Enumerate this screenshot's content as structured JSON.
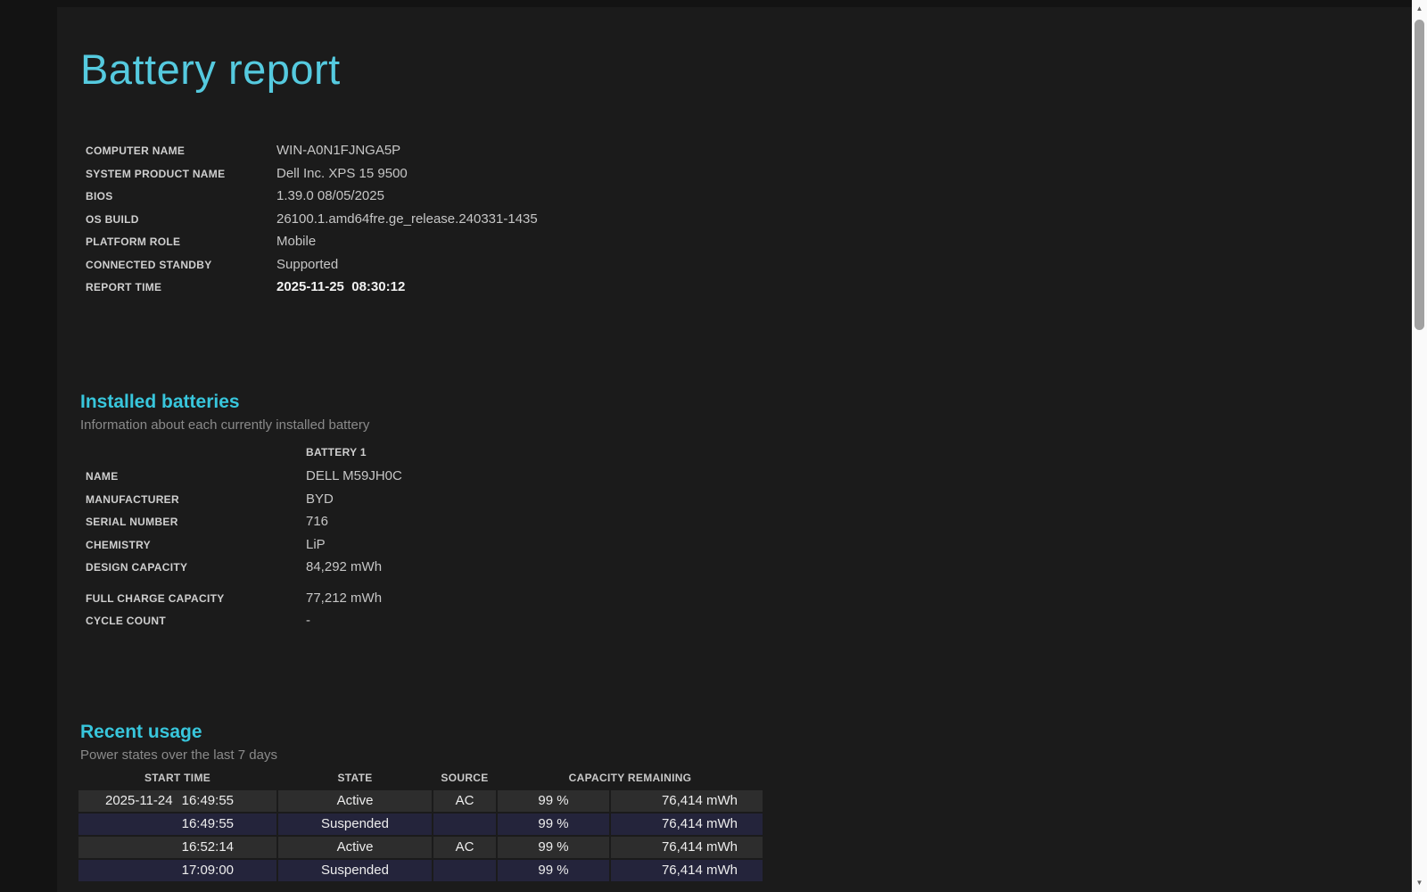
{
  "colors": {
    "outer_background": "#131313",
    "page_background": "#1b1b1b",
    "title_accent": "#55cadf",
    "heading_accent": "#38c6dc",
    "active_row_background": "#2d2d2d",
    "suspended_row_background": "#24243b"
  },
  "report": {
    "title": "Battery report"
  },
  "system_info": {
    "rows": [
      {
        "label": "COMPUTER NAME",
        "value": "WIN-A0N1FJNGA5P"
      },
      {
        "label": "SYSTEM PRODUCT NAME",
        "value": "Dell Inc. XPS 15 9500"
      },
      {
        "label": "BIOS",
        "value": "1.39.0 08/05/2025"
      },
      {
        "label": "OS BUILD",
        "value": "26100.1.amd64fre.ge_release.240331-1435"
      },
      {
        "label": "PLATFORM ROLE",
        "value": "Mobile"
      },
      {
        "label": "CONNECTED STANDBY",
        "value": "Supported"
      },
      {
        "label": "REPORT TIME",
        "value": "2025-11-25  08:30:12"
      }
    ]
  },
  "installed_batteries": {
    "heading": "Installed batteries",
    "subtitle": "Information about each currently installed battery",
    "battery_column_header": "BATTERY 1",
    "rows": [
      {
        "label": "NAME",
        "value": "DELL M59JH0C"
      },
      {
        "label": "MANUFACTURER",
        "value": "BYD"
      },
      {
        "label": "SERIAL NUMBER",
        "value": "716"
      },
      {
        "label": "CHEMISTRY",
        "value": "LiP"
      },
      {
        "label": "DESIGN CAPACITY",
        "value": "84,292 mWh"
      },
      {
        "label": "FULL CHARGE CAPACITY",
        "value": "77,212 mWh"
      },
      {
        "label": "CYCLE COUNT",
        "value": "-"
      }
    ]
  },
  "recent_usage": {
    "heading": "Recent usage",
    "subtitle": "Power states over the last 7 days",
    "table": {
      "headers": {
        "start_time": "START TIME",
        "state": "STATE",
        "source": "SOURCE",
        "capacity_remaining": "CAPACITY REMAINING"
      },
      "rows": [
        {
          "date": "2025-11-24",
          "time": "16:49:55",
          "state": "Active",
          "source": "AC",
          "capacity_pct": "99 %",
          "capacity_mwh": "76,414 mWh",
          "row_type": "active"
        },
        {
          "date": "",
          "time": "16:49:55",
          "state": "Suspended",
          "source": "",
          "capacity_pct": "99 %",
          "capacity_mwh": "76,414 mWh",
          "row_type": "suspended"
        },
        {
          "date": "",
          "time": "16:52:14",
          "state": "Active",
          "source": "AC",
          "capacity_pct": "99 %",
          "capacity_mwh": "76,414 mWh",
          "row_type": "active"
        },
        {
          "date": "",
          "time": "17:09:00",
          "state": "Suspended",
          "source": "",
          "capacity_pct": "99 %",
          "capacity_mwh": "76,414 mWh",
          "row_type": "suspended"
        }
      ]
    }
  },
  "scrollbar": {
    "up_arrow": "▲",
    "down_arrow": "▼"
  }
}
